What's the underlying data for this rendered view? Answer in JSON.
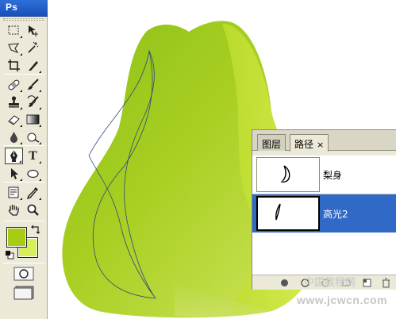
{
  "app": {
    "badge": "Ps"
  },
  "toolbox": {
    "tools": [
      {
        "name": "marquee-tool-icon"
      },
      {
        "name": "move-tool-icon"
      },
      {
        "name": "lasso-tool-icon"
      },
      {
        "name": "magic-wand-tool-icon"
      },
      {
        "name": "crop-tool-icon"
      },
      {
        "name": "slice-tool-icon"
      },
      {
        "name": "healing-brush-tool-icon"
      },
      {
        "name": "brush-tool-icon"
      },
      {
        "name": "clone-stamp-tool-icon"
      },
      {
        "name": "history-brush-tool-icon"
      },
      {
        "name": "eraser-tool-icon"
      },
      {
        "name": "gradient-tool-icon"
      },
      {
        "name": "blur-tool-icon"
      },
      {
        "name": "dodge-tool-icon"
      },
      {
        "name": "pen-tool-icon"
      },
      {
        "name": "type-tool-icon"
      },
      {
        "name": "path-selection-tool-icon"
      },
      {
        "name": "shape-tool-icon"
      },
      {
        "name": "notes-tool-icon"
      },
      {
        "name": "eyedropper-tool-icon"
      },
      {
        "name": "hand-tool-icon"
      },
      {
        "name": "zoom-tool-icon"
      }
    ],
    "active_tool": "pen-tool-icon",
    "type_tool_label": "T",
    "foreground_color": "#a8cc14",
    "background_color": "#d6ee5c"
  },
  "panel": {
    "tabs": [
      {
        "label": "图层",
        "active": false
      },
      {
        "label": "路径",
        "active": true
      }
    ],
    "close_glyph": "×",
    "paths": [
      {
        "name": "梨身",
        "selected": false
      },
      {
        "name": "高光2",
        "selected": true
      }
    ]
  },
  "watermark": {
    "text": "www.jcwcn.com",
    "top_text": "中国教程网"
  },
  "colors": {
    "pear_dark": "#7fb80f",
    "pear_mid": "#a6cf1f",
    "pear_light": "#cfe65a",
    "selection_blue": "#3169c6"
  }
}
